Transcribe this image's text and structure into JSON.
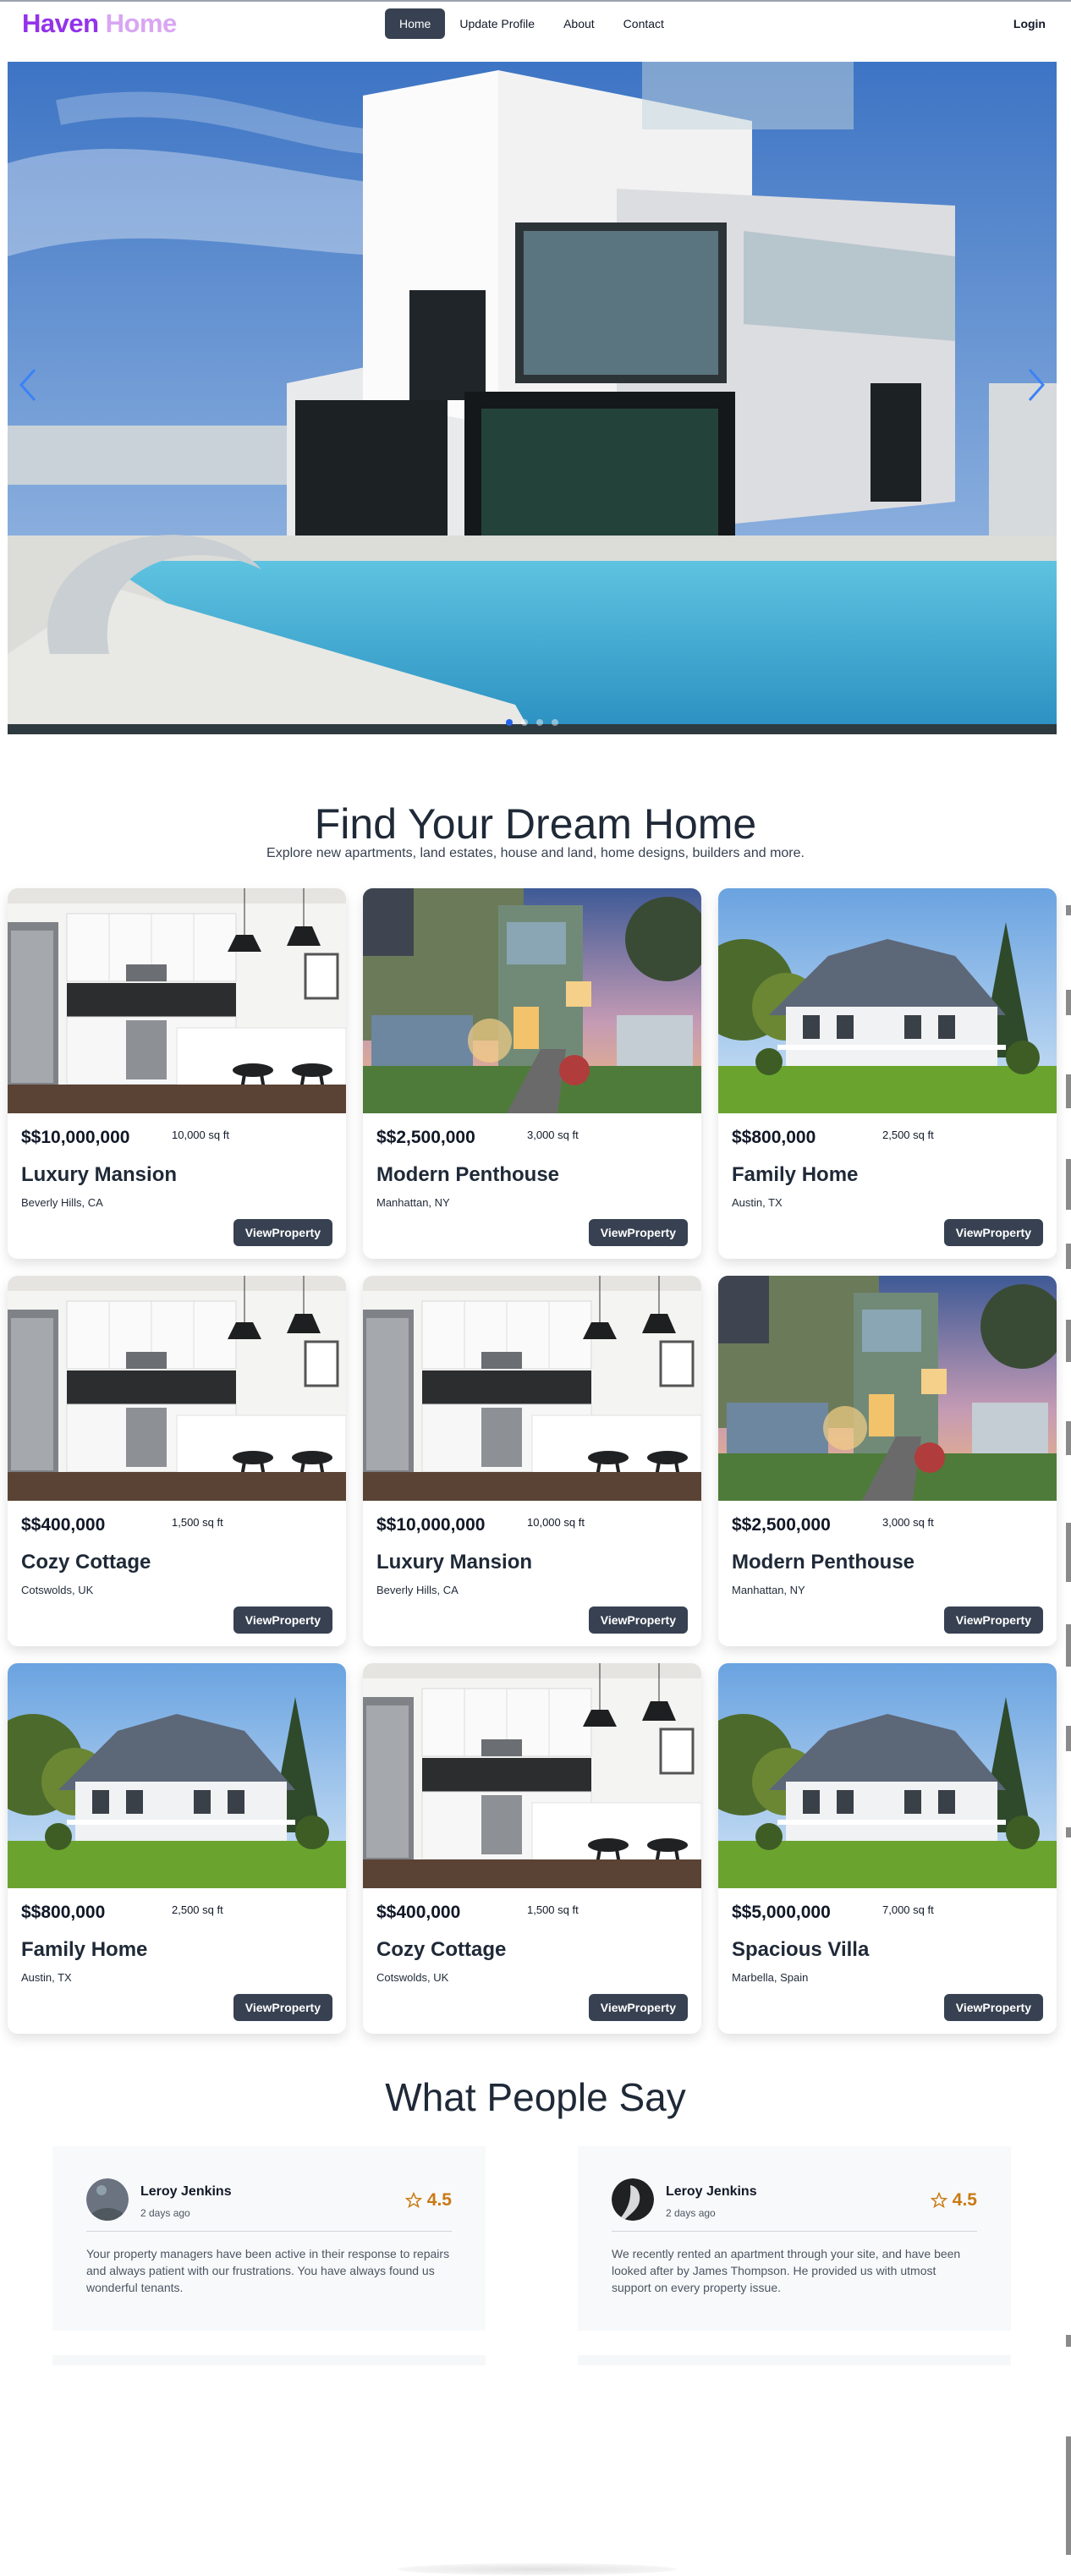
{
  "nav": {
    "brand_part1": "Haven",
    "brand_part2": "Home",
    "links": [
      {
        "label": "Home",
        "active": true
      },
      {
        "label": "Update Profile",
        "active": false
      },
      {
        "label": "About",
        "active": false
      },
      {
        "label": "Contact",
        "active": false
      }
    ],
    "login_label": "Login"
  },
  "hero": {
    "prev_icon": "chevron-left-icon",
    "next_icon": "chevron-right-icon",
    "slide_count": 4,
    "active_slide": 1
  },
  "listings": {
    "title": "Find Your Dream Home",
    "subtitle": "Explore new apartments, land estates, house and land, home designs, builders and more.",
    "button_label": "ViewProperty",
    "cards": [
      {
        "price": "$$10,000,000",
        "area": "10,000 sq ft",
        "title": "Luxury Mansion",
        "location": "Beverly Hills, CA",
        "image": "kitchen"
      },
      {
        "price": "$$2,500,000",
        "area": "3,000 sq ft",
        "title": "Modern Penthouse",
        "location": "Manhattan, NY",
        "image": "modern-house"
      },
      {
        "price": "$$800,000",
        "area": "2,500 sq ft",
        "title": "Family Home",
        "location": "Austin, TX",
        "image": "family-house"
      },
      {
        "price": "$$400,000",
        "area": "1,500 sq ft",
        "title": "Cozy Cottage",
        "location": "Cotswolds, UK",
        "image": "kitchen"
      },
      {
        "price": "$$10,000,000",
        "area": "10,000 sq ft",
        "title": "Luxury Mansion",
        "location": "Beverly Hills, CA",
        "image": "kitchen"
      },
      {
        "price": "$$2,500,000",
        "area": "3,000 sq ft",
        "title": "Modern Penthouse",
        "location": "Manhattan, NY",
        "image": "modern-house"
      },
      {
        "price": "$$800,000",
        "area": "2,500 sq ft",
        "title": "Family Home",
        "location": "Austin, TX",
        "image": "family-house"
      },
      {
        "price": "$$400,000",
        "area": "1,500 sq ft",
        "title": "Cozy Cottage",
        "location": "Cotswolds, UK",
        "image": "kitchen"
      },
      {
        "price": "$$5,000,000",
        "area": "7,000 sq ft",
        "title": "Spacious Villa",
        "location": "Marbella, Spain",
        "image": "family-house"
      }
    ]
  },
  "testimonials": {
    "title": "What People Say",
    "items": [
      {
        "name": "Leroy Jenkins",
        "date": "2 days ago",
        "rating": "4.5",
        "text": "Your property managers have been active in their response to repairs and always patient with our frustrations. You have always found us wonderful tenants."
      },
      {
        "name": "Leroy Jenkins",
        "date": "2 days ago",
        "rating": "4.5",
        "text": "We recently rented an apartment through your site, and have been looked after by James Thompson. He provided us with utmost support on every property issue."
      }
    ]
  },
  "colors": {
    "brand_primary": "#9333ea",
    "brand_light": "#d8a6f2",
    "button_dark": "#374151",
    "rating": "#c97a14"
  }
}
